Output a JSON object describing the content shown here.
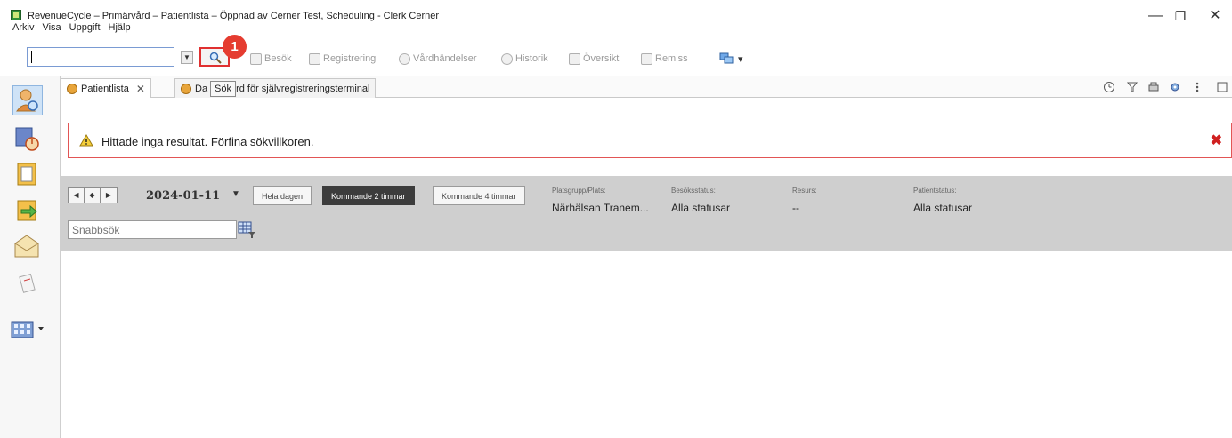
{
  "window": {
    "title": "RevenueCycle – Primärvård – Patientlista – Öppnad av Cerner Test, Scheduling - Clerk Cerner",
    "controls": {
      "minimize": "—",
      "maximize": "❐",
      "close": "✕"
    }
  },
  "menu": {
    "items": [
      "Arkiv",
      "Visa",
      "Uppgift",
      "Hjälp"
    ]
  },
  "toolbar": {
    "search_value": "",
    "search_button_tooltip": "Sök",
    "step_badge": "1",
    "items": [
      "Besök",
      "Registrering",
      "Vårdhändelser",
      "Historik",
      "Översikt",
      "Remiss"
    ]
  },
  "tabs": [
    {
      "label": "Patientlista",
      "close": "✕",
      "active": true
    },
    {
      "label_start": "Da",
      "label_end": "rd för självregistreringsterminal",
      "active": false
    }
  ],
  "alert": {
    "message": "Hittade inga resultat. Förfina sökvillkoren.",
    "close": "✖"
  },
  "schedule": {
    "nav": [
      "◀",
      "◆",
      "▶"
    ],
    "date": "2024-01-11",
    "date_caret": "▼",
    "ranges": [
      {
        "label": "Hela dagen",
        "active": false
      },
      {
        "label": "Kommande 2 timmar",
        "active": true
      },
      {
        "label": "Kommande 4 timmar",
        "active": false
      }
    ],
    "fields": [
      {
        "label": "Platsgrupp/Plats:",
        "value": "Närhälsan Tranem..."
      },
      {
        "label": "Besöksstatus:",
        "value": "Alla statusar"
      },
      {
        "label": "Resurs:",
        "value": "--"
      },
      {
        "label": "Patientstatus:",
        "value": "Alla statusar"
      }
    ],
    "quicksearch_placeholder": "Snabbsök"
  },
  "colors": {
    "alert_border": "#e25555",
    "active_range": "#3c3c3c",
    "badge": "#e53c30",
    "highlight_border": "#e03030"
  }
}
